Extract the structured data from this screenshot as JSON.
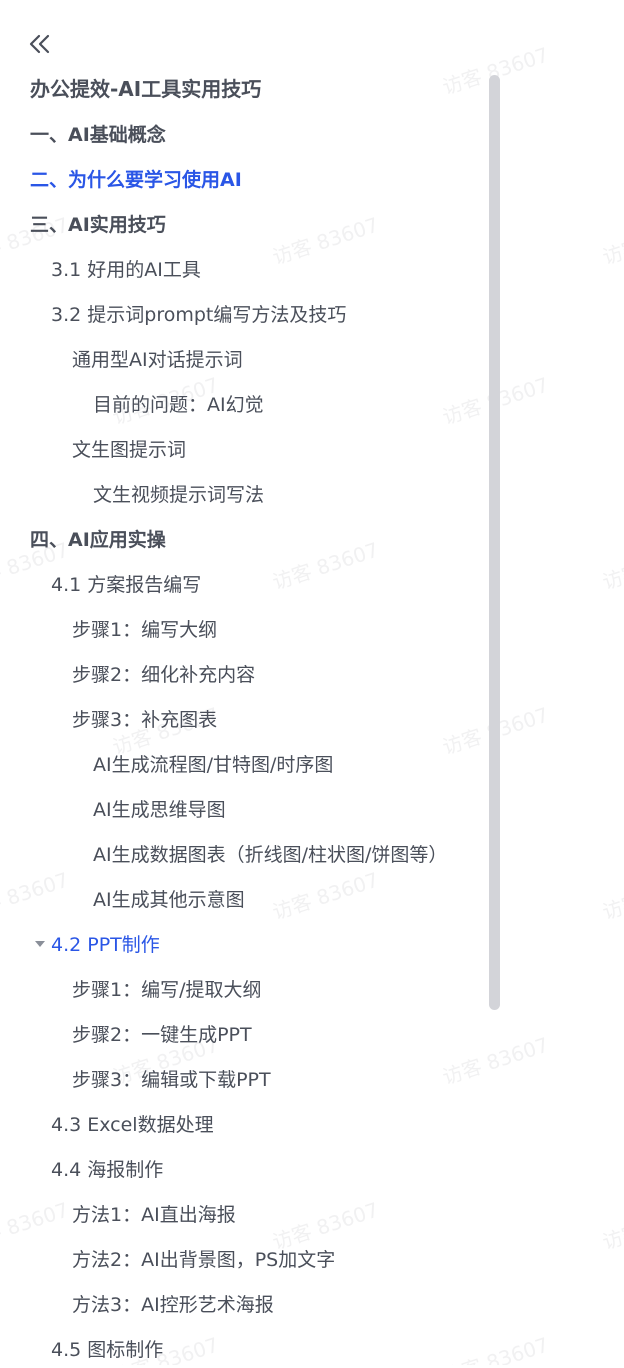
{
  "nav": {
    "collapse_icon": "double-chevron-left-icon"
  },
  "doc_title": "办公提效-AI工具实用技巧",
  "colors": {
    "text": "#4a4f5a",
    "active": "#2a56e6",
    "scrollbar": "#d3d4d9"
  },
  "watermark_text": "访客 83607",
  "toc": [
    {
      "label": "一、AI基础概念",
      "level": 1
    },
    {
      "label": "二、为什么要学习使用AI",
      "level": 1,
      "active": true
    },
    {
      "label": "三、AI实用技巧",
      "level": 1
    },
    {
      "label": "3.1 好用的AI工具",
      "level": 2
    },
    {
      "label": "3.2 提示词prompt编写方法及技巧",
      "level": 2
    },
    {
      "label": "通用型AI对话提示词",
      "level": 3
    },
    {
      "label": "目前的问题：AI幻觉",
      "level": 4
    },
    {
      "label": "文生图提示词",
      "level": 3
    },
    {
      "label": "文生视频提示词写法",
      "level": 4
    },
    {
      "label": "四、AI应用实操",
      "level": 1
    },
    {
      "label": "4.1 方案报告编写",
      "level": 2
    },
    {
      "label": "步骤1：编写大纲",
      "level": 3
    },
    {
      "label": "步骤2：细化补充内容",
      "level": 3
    },
    {
      "label": "步骤3：补充图表",
      "level": 3
    },
    {
      "label": "AI生成流程图/甘特图/时序图",
      "level": 4
    },
    {
      "label": "AI生成思维导图",
      "level": 4
    },
    {
      "label": "AI生成数据图表（折线图/柱状图/饼图等）",
      "level": 4
    },
    {
      "label": "AI生成其他示意图",
      "level": 4
    },
    {
      "label": "4.2 PPT制作",
      "level": 2,
      "active": true,
      "expanded": true
    },
    {
      "label": "步骤1：编写/提取大纲",
      "level": 3
    },
    {
      "label": "步骤2：一键生成PPT",
      "level": 3
    },
    {
      "label": "步骤3：编辑或下载PPT",
      "level": 3
    },
    {
      "label": "4.3 Excel数据处理",
      "level": 2
    },
    {
      "label": "4.4 海报制作",
      "level": 2
    },
    {
      "label": "方法1：AI直出海报",
      "level": 3
    },
    {
      "label": "方法2：AI出背景图，PS加文字",
      "level": 3
    },
    {
      "label": "方法3：AI控形艺术海报",
      "level": 3
    },
    {
      "label": "4.5 图标制作",
      "level": 2
    }
  ]
}
